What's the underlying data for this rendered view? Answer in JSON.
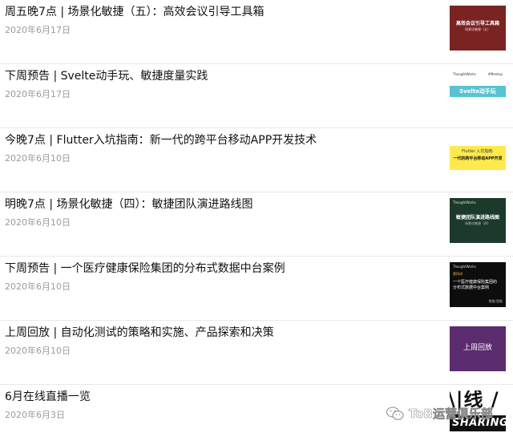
{
  "articles": [
    {
      "title": "周五晚7点 | 场景化敏捷（五）：高效会议引导工具箱",
      "date": "2020年6月17日",
      "thumb": {
        "main": "高效会议引导工具箱",
        "sub": "场景化敏捷（五）",
        "bg": "#7a2323"
      }
    },
    {
      "title": "下周预告 | Svelte动手玩、敏捷度量实践",
      "date": "2020年6月17日",
      "thumb": {
        "left": "ThoughtWorks",
        "right": "#Meetup",
        "main": "Svelte动手玩",
        "bg": "#58c3d2"
      }
    },
    {
      "title": "今晚7点 | Flutter入坑指南：新一代的跨平台移动APP开发技术",
      "date": "2020年6月10日",
      "thumb": {
        "line1": "Flutter 入坑指南:",
        "line2": "一代的跨平台移动APP开发",
        "bg": "#ffe94d"
      }
    },
    {
      "title": "明晚7点 | 场景化敏捷（四）：敏捷团队演进路线图",
      "date": "2020年6月10日",
      "thumb": {
        "left": "ThoughtWorks",
        "main": "敏捷团队演进路线图",
        "sub": "场景化敏捷（四）",
        "bg": "#1b3a2b"
      }
    },
    {
      "title": "下周预告 | 一个医疗健康保险集团的分布式数据中台案例",
      "date": "2020年6月10日",
      "thumb": {
        "left": "ThoughtWorks",
        "tag": "第四讲",
        "line1": "一个医疗健康保险集团的",
        "line2": "分布式数据中台案例",
        "line3": "",
        "foot": "数据·智能",
        "bg": "#0d0d0d"
      }
    },
    {
      "title": "上周回放 | 自动化测试的策略和实施、产品探索和决策",
      "date": "2020年6月10日",
      "thumb": {
        "main": "上周回放",
        "bg": "#5b2c6e"
      }
    },
    {
      "title": "6月在线直播一览",
      "date": "2020年6月3日",
      "thumb": {
        "big": "\\|线 / 5",
        "sharing": "SHARING",
        "bg": "#ffffff"
      }
    }
  ],
  "watermark": {
    "text": "ToB运营俱乐部",
    "icon": "wechat-icon"
  }
}
